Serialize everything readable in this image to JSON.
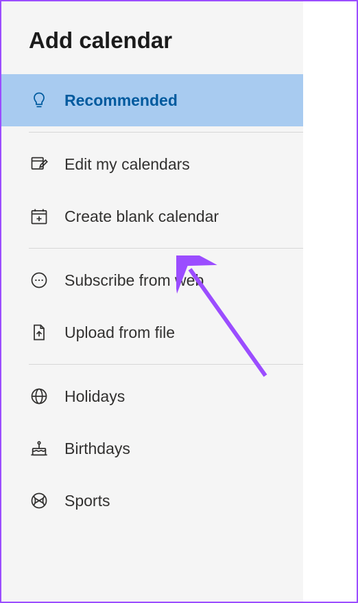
{
  "header": {
    "title": "Add calendar"
  },
  "menu": {
    "recommended": {
      "label": "Recommended"
    },
    "edit": {
      "label": "Edit my calendars"
    },
    "create": {
      "label": "Create blank calendar"
    },
    "subscribe": {
      "label": "Subscribe from web"
    },
    "upload": {
      "label": "Upload from file"
    },
    "holidays": {
      "label": "Holidays"
    },
    "birthdays": {
      "label": "Birthdays"
    },
    "sports": {
      "label": "Sports"
    }
  }
}
